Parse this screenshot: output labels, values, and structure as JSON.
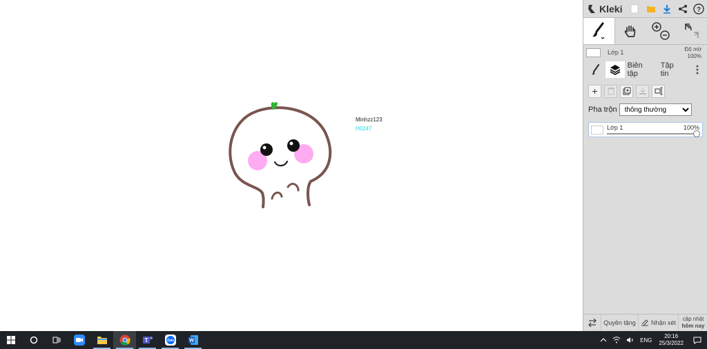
{
  "app": {
    "name": "Kleki"
  },
  "canvas": {
    "texts": [
      "Minhzz123",
      "H0247"
    ],
    "text_colors": {
      "name": "#222222",
      "tag": "#29d4e0"
    },
    "stroke_color": "#7a5550",
    "blush_color": "#ff8fe8",
    "sprout_color": "#2fb52f"
  },
  "toolbar_icons": [
    "new-image-icon",
    "import-folder-icon",
    "download-icon",
    "share-icon",
    "help-icon"
  ],
  "tools": [
    "brush-tool",
    "hand-tool",
    "zoom-tool",
    "undo-redo"
  ],
  "layer_preview": {
    "name": "Lớp 1",
    "opacity_label": "Độ mờ",
    "opacity_value": "100%"
  },
  "tabs": {
    "edit": "Biên tập",
    "file": "Tập tin"
  },
  "blend": {
    "label": "Pha trộn",
    "value": "thông thường",
    "options": [
      "thông thường"
    ]
  },
  "layers": [
    {
      "name": "Lớp 1",
      "opacity": "100%",
      "opacity_fraction": 1.0
    }
  ],
  "bottom": {
    "donate": "Quyên tặng",
    "feedback": "Nhận xét",
    "update_line1": "cập nhật",
    "update_line2": "hôm nay"
  },
  "taskbar": {
    "apps": [
      "start-icon",
      "search-icon",
      "task-view-icon",
      "zoom-app-icon",
      "file-explorer-icon",
      "chrome-icon",
      "teams-icon",
      "zalo-icon",
      "word-icon"
    ],
    "zalo_label": "Zalo",
    "lang": "ENG",
    "time": "20:16",
    "date": "25/3/2022"
  }
}
